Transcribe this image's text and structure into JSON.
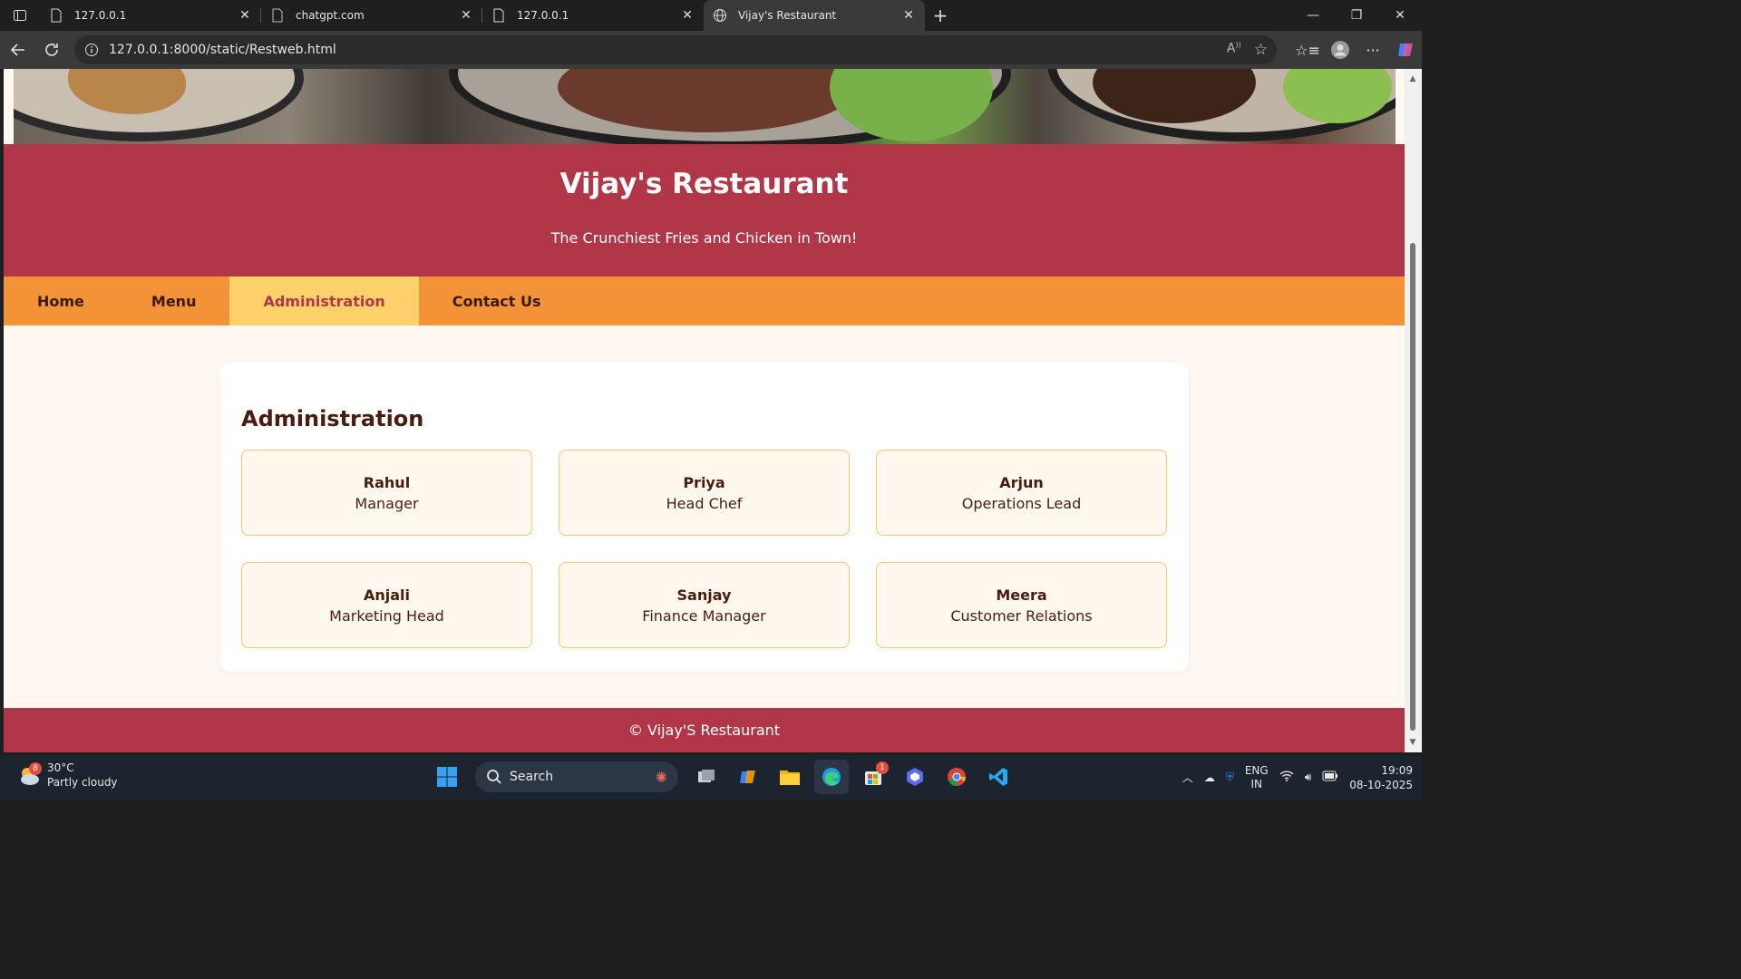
{
  "browser": {
    "tabs": [
      {
        "title": "127.0.0.1",
        "active": false
      },
      {
        "title": "chatgpt.com",
        "active": false
      },
      {
        "title": "127.0.0.1",
        "active": false
      },
      {
        "title": "Vijay's Restaurant",
        "active": true
      }
    ],
    "url": "127.0.0.1:8000/static/Restweb.html"
  },
  "page": {
    "title": "Vijay's Restaurant",
    "tagline": "The Crunchiest Fries and Chicken in Town!",
    "nav": [
      {
        "label": "Home",
        "active": false
      },
      {
        "label": "Menu",
        "active": false
      },
      {
        "label": "Administration",
        "active": true
      },
      {
        "label": "Contact Us",
        "active": false
      }
    ],
    "section_title": "Administration",
    "staff": [
      {
        "name": "Rahul",
        "role": "Manager"
      },
      {
        "name": "Priya",
        "role": "Head Chef"
      },
      {
        "name": "Arjun",
        "role": "Operations Lead"
      },
      {
        "name": "Anjali",
        "role": "Marketing Head"
      },
      {
        "name": "Sanjay",
        "role": "Finance Manager"
      },
      {
        "name": "Meera",
        "role": "Customer Relations"
      }
    ],
    "footer": "© Vijay'S Restaurant"
  },
  "taskbar": {
    "weather_temp": "30°C",
    "weather_desc": "Partly cloudy",
    "weather_badge": "8",
    "search_label": "Search",
    "store_badge": "1",
    "lang_top": "ENG",
    "lang_bottom": "IN",
    "time": "19:09",
    "date": "08-10-2025"
  },
  "colors": {
    "header": "#b03648",
    "nav": "#f39237",
    "nav_active": "#ffd16b",
    "page_bg": "#fff8f0"
  }
}
